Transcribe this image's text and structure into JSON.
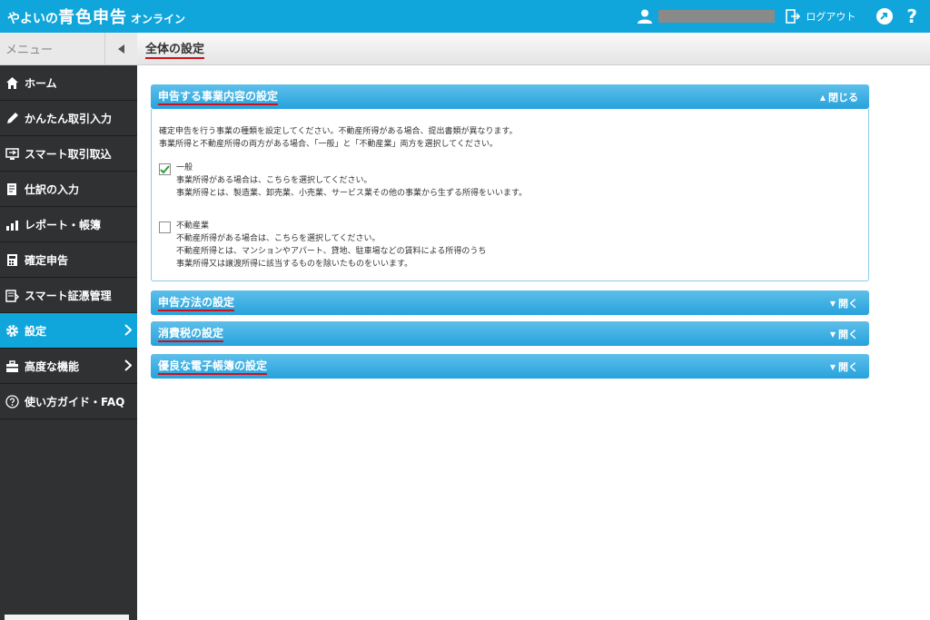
{
  "header": {
    "logo_prefix": "やよいの",
    "logo_main": "青色申告",
    "logo_suffix": "オンライン",
    "logout_label": "ログアウト",
    "help_label": "?"
  },
  "sidebar": {
    "menu_label": "メニュー",
    "items": [
      {
        "label": "ホーム",
        "icon": "home-icon"
      },
      {
        "label": "かんたん取引入力",
        "icon": "pencil-icon"
      },
      {
        "label": "スマート取引取込",
        "icon": "import-icon"
      },
      {
        "label": "仕訳の入力",
        "icon": "journal-icon"
      },
      {
        "label": "レポート・帳簿",
        "icon": "chart-icon"
      },
      {
        "label": "確定申告",
        "icon": "calculator-icon"
      },
      {
        "label": "スマート証憑管理",
        "icon": "document-icon"
      },
      {
        "label": "設定",
        "icon": "gear-icon",
        "active": true
      },
      {
        "label": "高度な機能",
        "icon": "toolbox-icon"
      },
      {
        "label": "使い方ガイド・FAQ",
        "icon": "question-circle-icon"
      }
    ]
  },
  "main": {
    "page_title": "全体の設定",
    "panels": [
      {
        "title": "申告する事業内容の設定",
        "toggle": "閉じる"
      },
      {
        "title": "申告方法の設定",
        "toggle": "開く"
      },
      {
        "title": "消費税の設定",
        "toggle": "開く"
      },
      {
        "title": "優良な電子帳簿の設定",
        "toggle": "開く"
      }
    ],
    "business_panel": {
      "desc1": "確定申告を行う事業の種類を設定してください。不動産所得がある場合、提出書類が異なります。",
      "desc2": "事業所得と不動産所得の両方がある場合、「一般」と「不動産業」両方を選択してください。",
      "option1": {
        "label": "一般",
        "checked": true,
        "lines": [
          "事業所得がある場合は、こちらを選択してください。",
          "事業所得とは、製造業、卸売業、小売業、サービス業その他の事業から生ずる所得をいいます。"
        ]
      },
      "option2": {
        "label": "不動産業",
        "checked": false,
        "lines": [
          "不動産所得がある場合は、こちらを選択してください。",
          "不動産所得とは、マンションやアパート、貸地、駐車場などの賃料による所得のうち",
          "事業所得又は譲渡所得に該当するものを除いたものをいいます。"
        ]
      }
    }
  },
  "colors": {
    "header_blue": "#10a6dc",
    "sidebar_dark": "#2f3132",
    "panel_blue": "#27a2dc",
    "underline_red": "#d0111b",
    "check_green": "#2e9e3a"
  }
}
